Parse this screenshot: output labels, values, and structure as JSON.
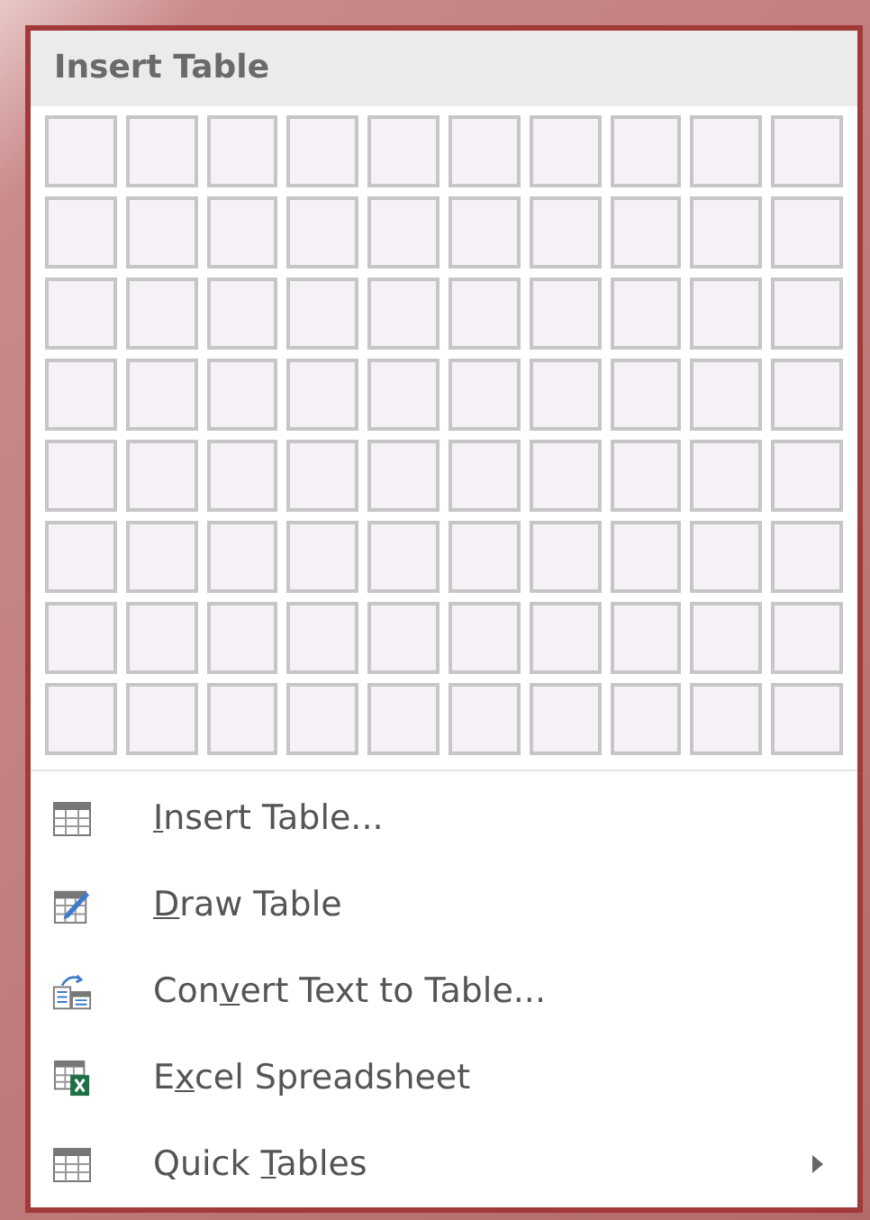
{
  "title": "Insert Table",
  "grid": [
    {
      "cells": [
        {
          "selected": false
        },
        {
          "selected": false
        },
        {
          "selected": false
        },
        {
          "selected": false
        },
        {
          "selected": false
        },
        {
          "selected": false
        },
        {
          "selected": false
        },
        {
          "selected": false
        },
        {
          "selected": false
        },
        {
          "selected": false
        }
      ]
    },
    {
      "cells": [
        {
          "selected": false
        },
        {
          "selected": false
        },
        {
          "selected": false
        },
        {
          "selected": false
        },
        {
          "selected": false
        },
        {
          "selected": false
        },
        {
          "selected": false
        },
        {
          "selected": false
        },
        {
          "selected": false
        },
        {
          "selected": false
        }
      ]
    },
    {
      "cells": [
        {
          "selected": false
        },
        {
          "selected": false
        },
        {
          "selected": false
        },
        {
          "selected": false
        },
        {
          "selected": false
        },
        {
          "selected": false
        },
        {
          "selected": false
        },
        {
          "selected": false
        },
        {
          "selected": false
        },
        {
          "selected": false
        }
      ]
    },
    {
      "cells": [
        {
          "selected": false
        },
        {
          "selected": false
        },
        {
          "selected": false
        },
        {
          "selected": false
        },
        {
          "selected": false
        },
        {
          "selected": false
        },
        {
          "selected": false
        },
        {
          "selected": false
        },
        {
          "selected": false
        },
        {
          "selected": false
        }
      ]
    },
    {
      "cells": [
        {
          "selected": false
        },
        {
          "selected": false
        },
        {
          "selected": false
        },
        {
          "selected": false
        },
        {
          "selected": false
        },
        {
          "selected": false
        },
        {
          "selected": false
        },
        {
          "selected": false
        },
        {
          "selected": false
        },
        {
          "selected": false
        }
      ]
    },
    {
      "cells": [
        {
          "selected": false
        },
        {
          "selected": false
        },
        {
          "selected": false
        },
        {
          "selected": false
        },
        {
          "selected": false
        },
        {
          "selected": false
        },
        {
          "selected": false
        },
        {
          "selected": false
        },
        {
          "selected": false
        },
        {
          "selected": false
        }
      ]
    },
    {
      "cells": [
        {
          "selected": false
        },
        {
          "selected": false
        },
        {
          "selected": false
        },
        {
          "selected": false
        },
        {
          "selected": false
        },
        {
          "selected": false
        },
        {
          "selected": false
        },
        {
          "selected": false
        },
        {
          "selected": false
        },
        {
          "selected": false
        }
      ]
    },
    {
      "cells": [
        {
          "selected": false
        },
        {
          "selected": false
        },
        {
          "selected": false
        },
        {
          "selected": false
        },
        {
          "selected": false
        },
        {
          "selected": false
        },
        {
          "selected": false
        },
        {
          "selected": false
        },
        {
          "selected": false
        },
        {
          "selected": false
        }
      ]
    }
  ],
  "menu": [
    {
      "kind": "table",
      "key": "I",
      "post": "nsert Table...",
      "submenu": false
    },
    {
      "kind": "draw",
      "key": "D",
      "post": "raw Table",
      "submenu": false
    },
    {
      "kind": "convert",
      "pre": "Con",
      "key": "v",
      "post": "ert Text to Table...",
      "submenu": false
    },
    {
      "kind": "excel",
      "pre": "E",
      "key": "x",
      "post": "cel Spreadsheet",
      "submenu": false
    },
    {
      "kind": "table",
      "pre": "Quick ",
      "key": "T",
      "post": "ables",
      "submenu": true
    }
  ]
}
